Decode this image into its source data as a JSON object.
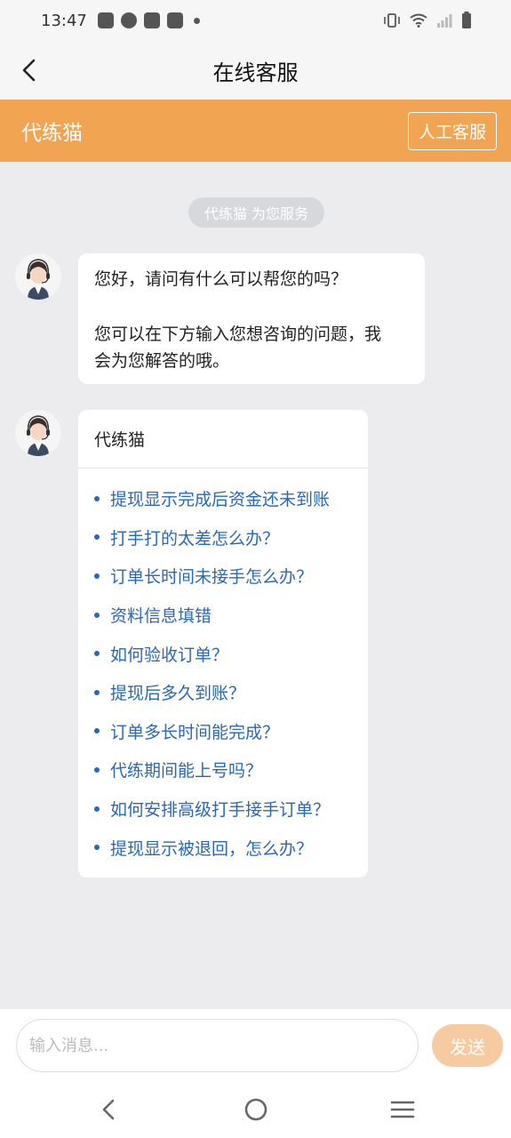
{
  "status_bar": {
    "time": "13:47",
    "icons": [
      "vivo-icon",
      "app-icon",
      "bag-icon",
      "bag-icon",
      "dot-icon"
    ],
    "right_icons": [
      "vibrate-icon",
      "wifi-icon",
      "signal-icon",
      "battery-icon"
    ]
  },
  "nav": {
    "title": "在线客服"
  },
  "service_header": {
    "name": "代练猫",
    "human_button": "人工客服"
  },
  "chat": {
    "system_tag": "代练猫 为您服务",
    "message1": {
      "line1": "您好，请问有什么可以帮您的吗？",
      "line2": "您可以在下方输入您想咨询的问题，我",
      "line3": "会为您解答的哦。"
    },
    "message2": {
      "title": "代练猫",
      "faqs": [
        "提现显示完成后资金还未到账",
        "打手打的太差怎么办？",
        "订单长时间未接手怎么办？",
        "资料信息填错",
        "如何验收订单？",
        "提现后多久到账？",
        "订单多长时间能完成？",
        "代练期间能上号吗？",
        "如何安排高级打手接手订单？",
        "提现显示被退回，怎么办？"
      ]
    }
  },
  "input": {
    "placeholder": "输入消息...",
    "send_label": "发送"
  },
  "colors": {
    "accent": "#f1a451",
    "link": "#2a68b4",
    "send_button": "#f7cba1"
  }
}
